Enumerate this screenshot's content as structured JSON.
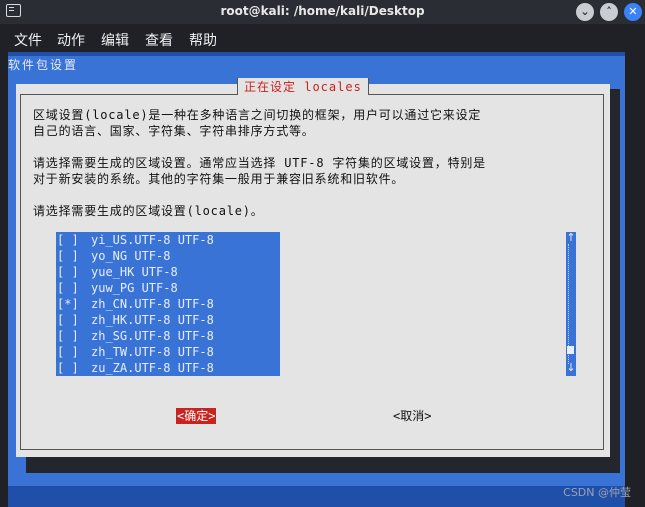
{
  "window": {
    "title": "root@kali: /home/kali/Desktop",
    "minimize_glyph": "⌄",
    "maximize_glyph": "˄",
    "close_glyph": "✕"
  },
  "menubar": [
    "文件",
    "动作",
    "编辑",
    "查看",
    "帮助"
  ],
  "background_title": "软件包设置",
  "dialog": {
    "title": "正在设定 locales",
    "paragraph1": [
      "区域设置(locale)是一种在多种语言之间切换的框架，用户可以通过它来设定",
      "自己的语言、国家、字符集、字符串排序方式等。"
    ],
    "paragraph2": [
      "请选择需要生成的区域设置。通常应当选择 UTF-8 字符集的区域设置，特别是",
      "对于新安装的系统。其他的字符集一般用于兼容旧系统和旧软件。"
    ],
    "prompt": "请选择需要生成的区域设置(locale)。",
    "locales": [
      {
        "checkbox": "[ ]",
        "name": "yi_US.UTF-8 UTF-8"
      },
      {
        "checkbox": "[ ]",
        "name": "yo_NG UTF-8"
      },
      {
        "checkbox": "[ ]",
        "name": "yue_HK UTF-8"
      },
      {
        "checkbox": "[ ]",
        "name": "yuw_PG UTF-8"
      },
      {
        "checkbox": "[*]",
        "name": "zh_CN.UTF-8 UTF-8"
      },
      {
        "checkbox": "[ ]",
        "name": "zh_HK.UTF-8 UTF-8"
      },
      {
        "checkbox": "[ ]",
        "name": "zh_SG.UTF-8 UTF-8"
      },
      {
        "checkbox": "[ ]",
        "name": "zh_TW.UTF-8 UTF-8"
      },
      {
        "checkbox": "[ ]",
        "name": "zu_ZA.UTF-8 UTF-8"
      }
    ],
    "scroll_up": "↑",
    "scroll_down": "↓",
    "ok_label": "<确定>",
    "cancel_label": "<取消>"
  },
  "watermark": "CSDN @仲莹",
  "colors": {
    "terminal_blue": "#1f4fa8",
    "panel_blue": "#3a73d6",
    "dialog_gray": "#e4e4e4",
    "title_red": "#c8231e"
  }
}
